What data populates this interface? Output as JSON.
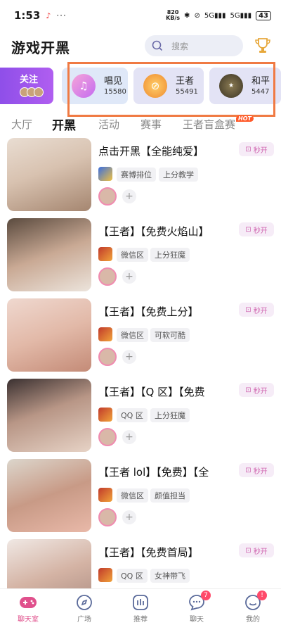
{
  "status_bar": {
    "time": "1:53",
    "speed_value": "820",
    "speed_unit": "KB/s",
    "battery": "43"
  },
  "header": {
    "title": "游戏开黑",
    "search_placeholder": "搜索"
  },
  "categories": [
    {
      "name": "关注",
      "count": ""
    },
    {
      "name": "唱见",
      "count": "15580"
    },
    {
      "name": "王者",
      "count": "55491"
    },
    {
      "name": "和平",
      "count": "5447"
    }
  ],
  "tabs": [
    "大厅",
    "开黑",
    "活动",
    "赛事",
    "王者盲盒赛"
  ],
  "hot_badge": "HOT",
  "quick_label": "秒开",
  "rooms": [
    {
      "title": "点击开黑【全能纯爱】",
      "tags": [
        "赛博排位",
        "上分教学"
      ]
    },
    {
      "title": "【王者】【免费火焰山】",
      "tags": [
        "微信区",
        "上分狂魔"
      ]
    },
    {
      "title": "【王者】【免费上分】",
      "tags": [
        "微信区",
        "可软可酷"
      ]
    },
    {
      "title": "【王者】【Q 区】【免费",
      "tags": [
        "QQ 区",
        "上分狂魔"
      ]
    },
    {
      "title": "【王者 lol】【免费】【全",
      "tags": [
        "微信区",
        "颜值担当"
      ]
    },
    {
      "title": "【王者】【免费首局】",
      "tags": [
        "QQ 区",
        "女神带飞"
      ]
    }
  ],
  "nav": [
    {
      "label": "聊天室",
      "badge": ""
    },
    {
      "label": "广场",
      "badge": ""
    },
    {
      "label": "推荐",
      "badge": ""
    },
    {
      "label": "聊天",
      "badge": "7"
    },
    {
      "label": "我的",
      "badge": "!"
    }
  ],
  "colors": {
    "accent": "#e0508c",
    "highlight_box": "#f07a43",
    "follow_card": "#9b55ea"
  }
}
